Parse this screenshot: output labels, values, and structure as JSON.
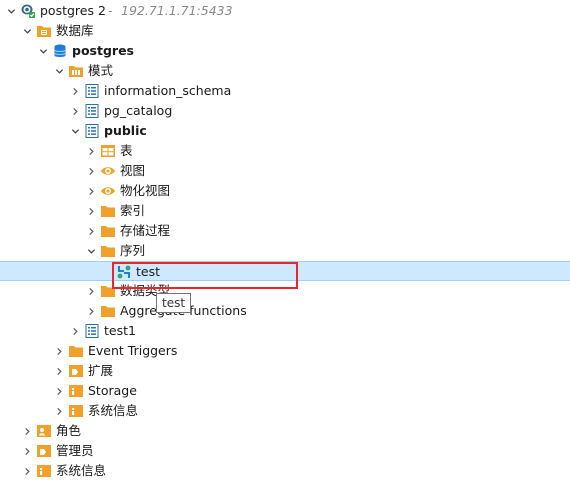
{
  "connection": {
    "name": "postgres 2",
    "host": "192.71.1.71:5433",
    "separator": "-"
  },
  "nodes": {
    "databases": "数据库",
    "postgres_db": "postgres",
    "schemas": "模式",
    "information_schema": "information_schema",
    "pg_catalog": "pg_catalog",
    "public": "public",
    "tables": "表",
    "views": "视图",
    "materialized_views": "物化视图",
    "indexes": "索引",
    "procedures": "存储过程",
    "sequences": "序列",
    "sequence_test": "test",
    "data_types": "数据类型",
    "aggregate_functions": "Aggregate functions",
    "test1": "test1",
    "event_triggers": "Event Triggers",
    "extensions": "扩展",
    "storage": "Storage",
    "system_info_db": "系统信息",
    "roles": "角色",
    "admins": "管理员",
    "system_info": "系统信息"
  },
  "tooltip": "test",
  "colors": {
    "folder": "#f0a12a",
    "db_blue": "#1e7fd8",
    "schema_blue": "#2b6fb5",
    "selection": "#cde8ff",
    "highlight": "#e8262b"
  }
}
